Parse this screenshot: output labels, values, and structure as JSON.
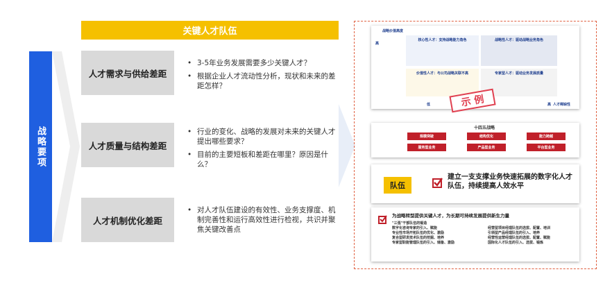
{
  "side_label": "战略要项",
  "header_title": "关键人才队伍",
  "categories": [
    {
      "label": "人才需求与供给差距",
      "bullets": [
        "3-5年业务发展需要多少关键人才？",
        "根据企业人才流动性分析，现状和未来的差距怎样？"
      ]
    },
    {
      "label": "人才质量与结构差距",
      "bullets": [
        "行业的变化、战略的发展对未来的关键人才提出哪些要求？",
        "目前的主要短板和差距在哪里？原因是什么？"
      ]
    },
    {
      "label": "人才机制优化差距",
      "bullets": [
        "对人才队伍建设的有效性、业务支撑度、机制完善性和运行高效性进行检视，共识并聚焦关键改善点"
      ]
    }
  ],
  "example": {
    "stamp": "示 例",
    "matrix": {
      "y_title": "战略价值高度",
      "y_high": "高",
      "x_low": "低",
      "x_high": "高",
      "x_title": "人才稀缺性",
      "q1": "核心性人才：支持战略能力角色",
      "q2": "战略性人才：驱动战略业务角色",
      "q3": "价值性人才：与公司战略关联不高",
      "q4": "专家型人才：驱动业务发展质量"
    },
    "strategy": {
      "title": "十四五战略",
      "cells": [
        "规模突破",
        "结构优化",
        "能力跨越",
        "服务型业务",
        "产品型业务",
        "平台型业务"
      ]
    },
    "team": {
      "badge": "队伍",
      "text": "建立一支支撑业务快速拓展的数字化人才队伍，持续提高人效水平"
    },
    "list": {
      "title": "为战略转型提供关键人才，为长期可持续发展提供新生力量",
      "left": [
        "\"三强\"干部队伍的锻造",
        "数字化咨询专家的引入、赋能",
        "专业性市场开拓队伍的优化、激励",
        "复合型研发技术队伍的挖掘、培养",
        "专家型职能管理队伍的引入、储备、激励"
      ],
      "right": [
        "经营型项目经理队伍的选拔、配置、培训",
        "引领型产品经理队伍的引入、培养",
        "经营性运营经理队伍的选拔、配置、赋能",
        "国际化人才队伍的引入、选拔、锻炼"
      ]
    }
  },
  "colors": {
    "blue": "#1f5fe0",
    "yellow": "#f5c000",
    "gray": "#d9d9d9",
    "red": "#c0202a"
  }
}
